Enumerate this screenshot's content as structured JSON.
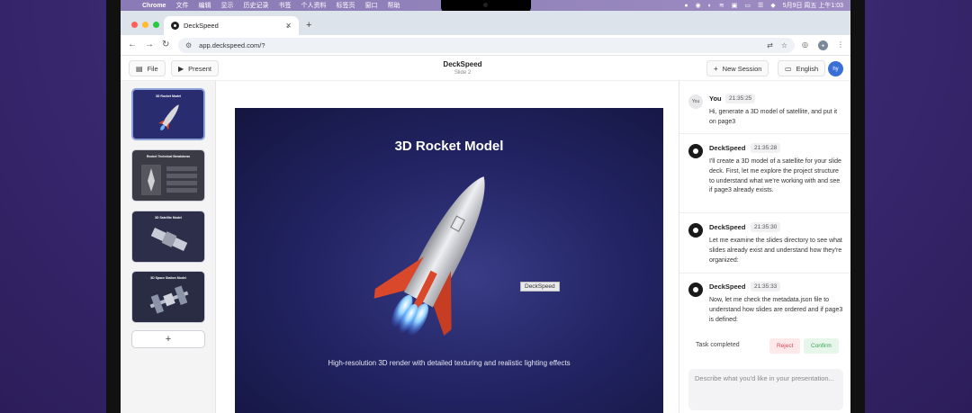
{
  "menubar": {
    "app_name": "Chrome",
    "items": [
      "文件",
      "编辑",
      "显示",
      "历史记录",
      "书签",
      "个人资料",
      "标签页",
      "窗口",
      "帮助"
    ],
    "clock": "5月9日 周五 上午1:03"
  },
  "browser": {
    "tab_title": "DeckSpeed",
    "url": "app.deckspeed.com/?"
  },
  "header": {
    "file_label": "File",
    "present_label": "Present",
    "title": "DeckSpeed",
    "subtitle": "Slide 2",
    "new_session_label": "New Session",
    "language_label": "English",
    "avatar_initials": "hy"
  },
  "thumbnails": [
    {
      "title": "3D Rocket Model",
      "bg": "#2a2c70"
    },
    {
      "title": "Rocket Technical Breakdown",
      "bg": "#3a3b44"
    },
    {
      "title": "3D Satellite Model",
      "bg": "#2d2f4a"
    },
    {
      "title": "3D Space Station Model",
      "bg": "#2a2c44"
    }
  ],
  "slide": {
    "title": "3D Rocket Model",
    "caption": "High-resolution 3D render with detailed texturing and realistic lighting effects",
    "tooltip": "DeckSpeed"
  },
  "chat": {
    "messages": [
      {
        "sender": "You",
        "avatar": "You",
        "time": "21:35:25",
        "text": "Hi, generate a 3D model of satellite, and put it on page3"
      },
      {
        "sender": "DeckSpeed",
        "time": "21:35:28",
        "text": "I'll create a 3D model of a satellite for your slide deck. First, let me explore the project structure to understand what we're working with and see if page3 already exists."
      },
      {
        "sender": "DeckSpeed",
        "time": "21:35:30",
        "text": "Let me examine the slides directory to see what slides already exist and understand how they're organized:"
      },
      {
        "sender": "DeckSpeed",
        "time": "21:35:33",
        "text": "Now, let me check the metadata.json file to understand how slides are ordered and if page3 is defined:"
      }
    ],
    "task_status": "Task completed",
    "reject_label": "Reject",
    "confirm_label": "Confirm",
    "input_placeholder": "Describe what you'd like in your presentation..."
  },
  "colors": {
    "accent": "#3a6fd8",
    "slide_bg": "#232566",
    "reject": "#d44a5a",
    "confirm": "#3aa35a"
  }
}
